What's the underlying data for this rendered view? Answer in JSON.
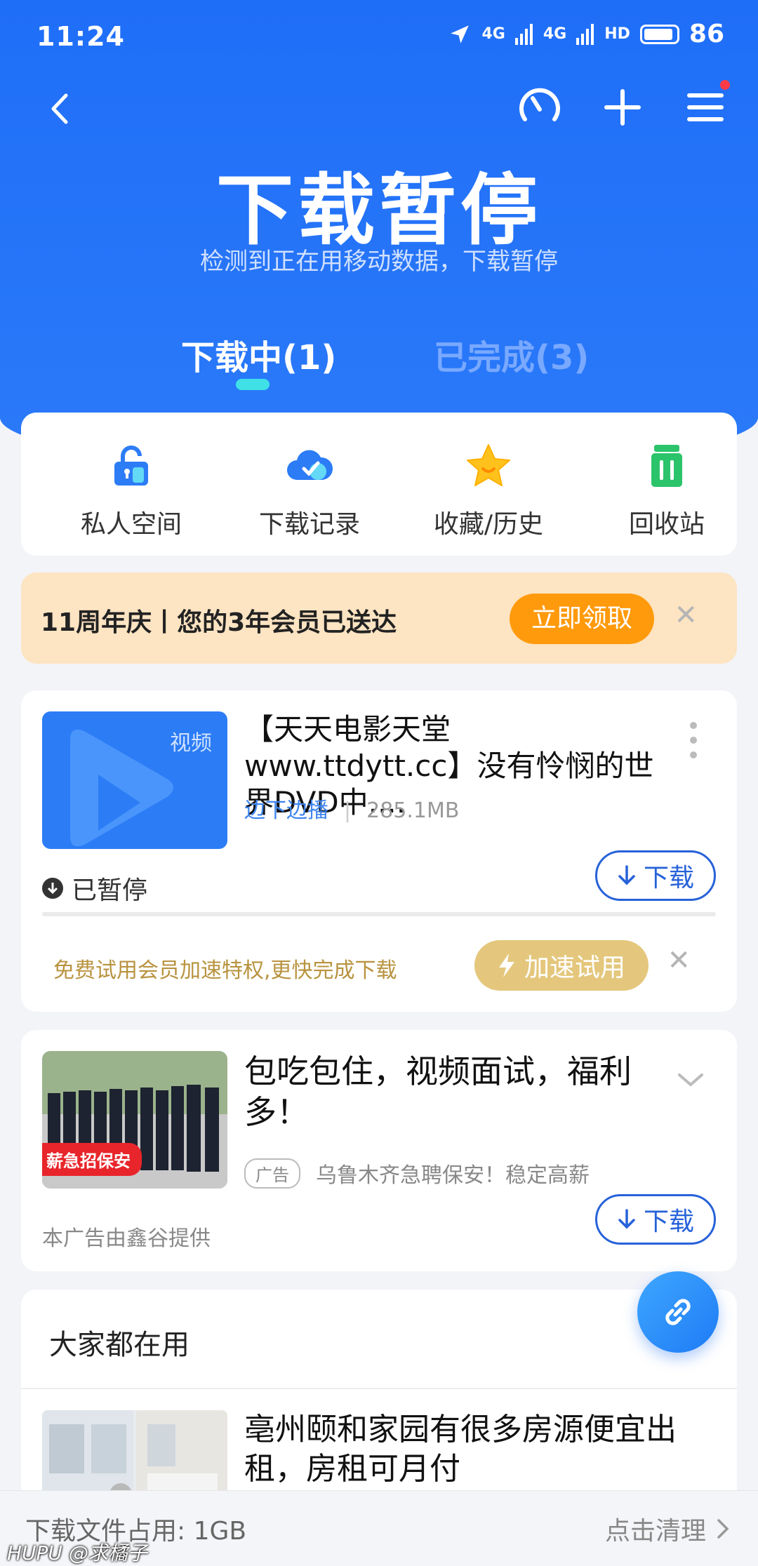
{
  "status_bar": {
    "time": "11:24",
    "signal_1": "4G",
    "signal_2": "4G",
    "hd": "HD",
    "battery": "86"
  },
  "hero": {
    "title": "下载暂停",
    "subtitle": "检测到正在用移动数据，下载暂停"
  },
  "tabs": [
    {
      "label": "下载中(1)",
      "active": true
    },
    {
      "label": "已完成(3)",
      "active": false
    }
  ],
  "quick_actions": [
    {
      "label": "私人空间",
      "icon": "lock-icon",
      "color": "#2c7cf6"
    },
    {
      "label": "下载记录",
      "icon": "cloud-check-icon",
      "color": "#2c7cf6"
    },
    {
      "label": "收藏/历史",
      "icon": "star-icon",
      "color": "#ffc21c"
    },
    {
      "label": "回收站",
      "icon": "trash-icon",
      "color": "#2cc46a"
    }
  ],
  "promo": {
    "text": "11周年庆丨您的3年会员已送达",
    "button": "立即领取"
  },
  "download_item": {
    "thumb_tag": "视频",
    "title": "【天天电影天堂www.ttdytt.cc】没有怜悯的世界DVD中....",
    "source": "边下边播",
    "size": "285.1MB",
    "status": "已暂停",
    "button": "下载",
    "progress": 0,
    "speed_text": "免费试用会员加速特权,更快完成下载",
    "speed_button": "加速试用"
  },
  "ad_item": {
    "thumb_label": "薪急招保安",
    "title": "包吃包住，视频面试，福利多！",
    "tag": "广告",
    "desc": "乌鲁木齐急聘保安！稳定高薪",
    "provider": "本广告由鑫谷提供",
    "button": "下载"
  },
  "recommend": {
    "title": "大家都在用",
    "item_title": "亳州颐和家园有很多房源便宜出租，房租可月付"
  },
  "footer": {
    "usage": "下载文件占用: 1GB",
    "action": "点击清理"
  },
  "watermark": "HUPU @求橘子",
  "colors": {
    "primary": "#2762d9",
    "header": "#1f6ef8",
    "promo_bg": "#fde4c2",
    "promo_btn": "#ff9a0c",
    "speed_btn": "#e4c77c"
  }
}
